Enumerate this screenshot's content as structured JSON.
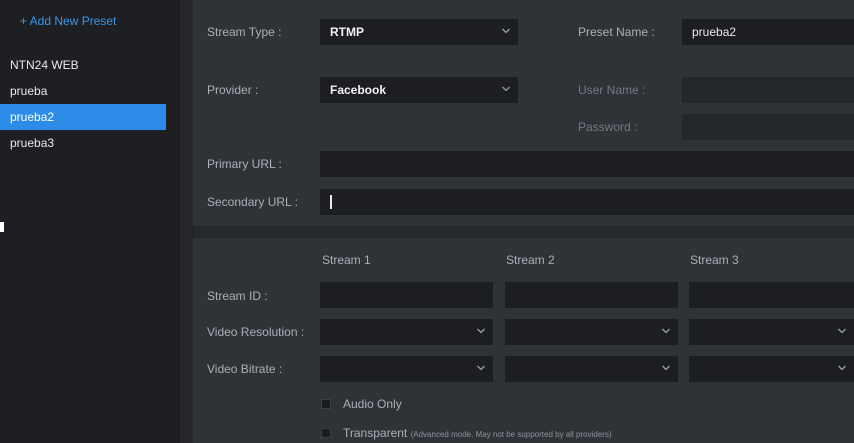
{
  "sidebar": {
    "add_preset_label": "+ Add New Preset",
    "presets": [
      {
        "label": "NTN24 WEB"
      },
      {
        "label": "prueba"
      },
      {
        "label": "prueba2"
      },
      {
        "label": "prueba3"
      }
    ],
    "active_index": 2
  },
  "stream": {
    "type_label": "Stream Type :",
    "type_value": "RTMP",
    "preset_name_label": "Preset Name :",
    "preset_name_value": "prueba2",
    "provider_label": "Provider :",
    "provider_value": "Facebook",
    "username_label": "User Name :",
    "password_label": "Password :",
    "primary_url_label": "Primary URL :",
    "secondary_url_label": "Secondary URL :"
  },
  "streams": {
    "columns": [
      "Stream 1",
      "Stream 2",
      "Stream 3"
    ],
    "stream_id_label": "Stream ID :",
    "video_resolution_label": "Video Resolution :",
    "video_bitrate_label": "Video Bitrate :",
    "audio_only_label": "Audio Only",
    "transparent_label": "Transparent",
    "transparent_note": "(Advanced mode. May not be supported by all providers)"
  },
  "colors": {
    "accent": "#2d8ce8",
    "link": "#3a97e8",
    "sidebar_bg": "#1d1f23",
    "panel_bg": "#2f3338",
    "field_bg": "#1c1e22"
  }
}
